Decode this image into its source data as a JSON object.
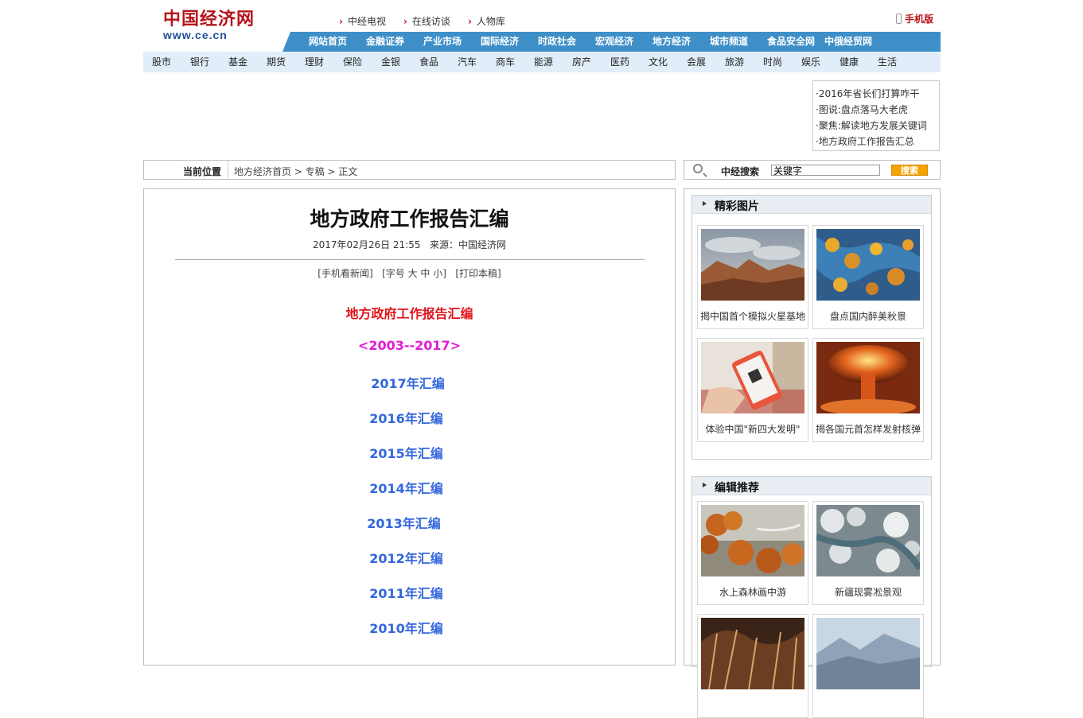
{
  "header": {
    "logo_cn": "中国经济网",
    "logo_en": "www.ce.cn",
    "top_links": [
      "中经电视",
      "在线访谈",
      "人物库"
    ],
    "mobile": "手机版"
  },
  "main_nav": [
    "网站首页",
    "金融证券",
    "产业市场",
    "国际经济",
    "时政社会",
    "宏观经济",
    "地方经济",
    "城市频道",
    "食品安全网",
    "中俄经贸网"
  ],
  "sub_nav": [
    "股市",
    "银行",
    "基金",
    "期货",
    "理财",
    "保险",
    "金银",
    "食品",
    "汽车",
    "商车",
    "能源",
    "房产",
    "医药",
    "文化",
    "会展",
    "旅游",
    "时尚",
    "娱乐",
    "健康",
    "生活"
  ],
  "headlines": [
    "2016年省长们打算咋干",
    "图说:盘点落马大老虎",
    "聚焦:解读地方发展关键词",
    "地方政府工作报告汇总"
  ],
  "breadcrumb": {
    "label": "当前位置",
    "path": "地方经济首页 > 专稿 > 正文"
  },
  "search": {
    "label": "中经搜索",
    "value": "关键字",
    "button": "搜索"
  },
  "article": {
    "title": "地方政府工作报告汇编",
    "date": "2017年02月26日 21:55",
    "source": "来源：中国经济网",
    "tools": [
      "[手机看新闻]",
      "[字号 大 中 小]",
      "[打印本稿]"
    ],
    "heading": "地方政府工作报告汇编",
    "range": "<2003--2017>",
    "links": [
      "2017年汇编",
      "2016年汇编",
      "2015年汇编",
      "2014年汇编",
      "2013年汇编",
      "2012年汇编",
      "2011年汇编",
      "2010年汇编"
    ]
  },
  "photos": {
    "title": "精彩图片",
    "items": [
      {
        "caption": "揭中国首个模拟火星基地"
      },
      {
        "caption": "盘点国内醉美秋景"
      },
      {
        "caption": "体验中国\"新四大发明\""
      },
      {
        "caption": "揭各国元首怎样发射核弹"
      }
    ]
  },
  "editor_picks": {
    "title": "编辑推荐",
    "items": [
      {
        "caption": "水上森林画中游"
      },
      {
        "caption": "新疆现雾凇景观"
      }
    ]
  }
}
